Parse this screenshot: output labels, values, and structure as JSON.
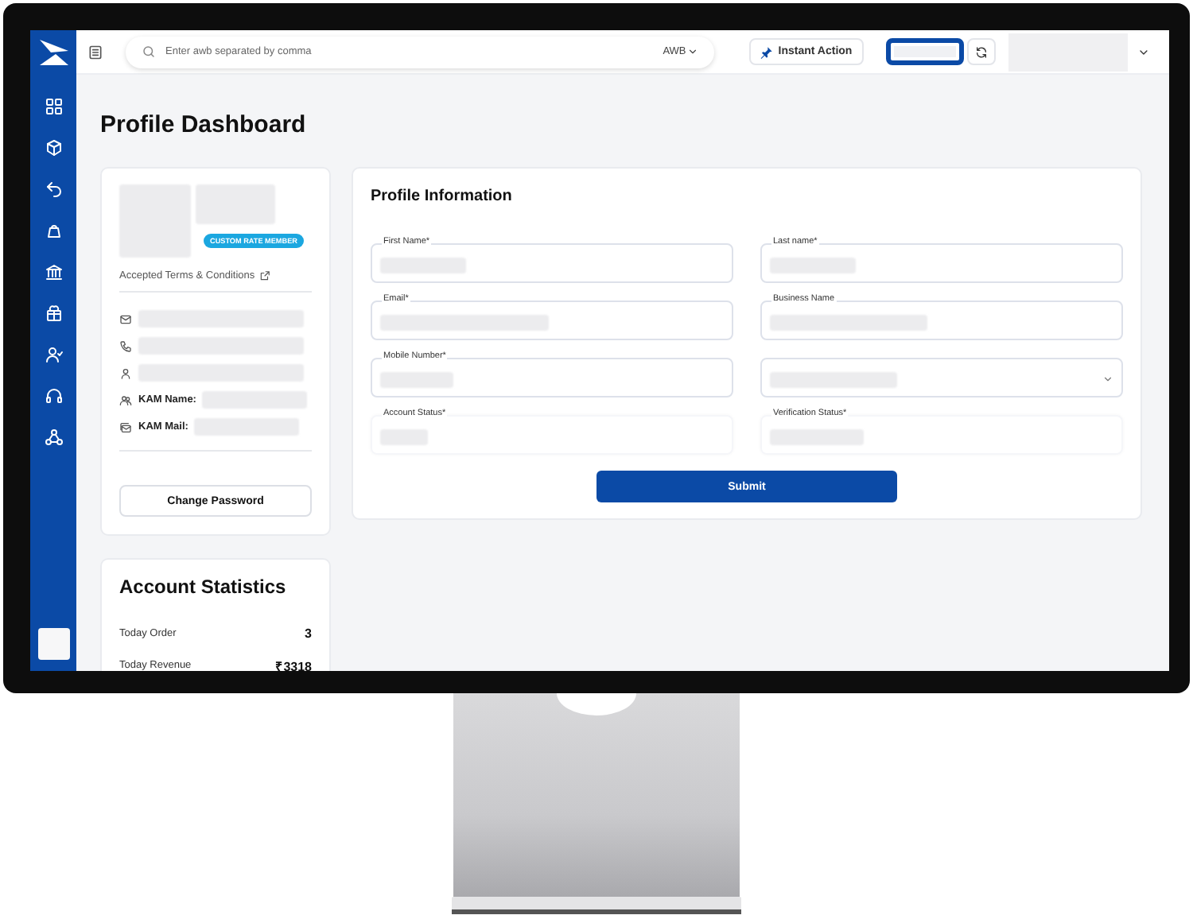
{
  "topbar": {
    "search_placeholder": "Enter awb separated by comma",
    "search_type": "AWB",
    "instant_action": "Instant Action"
  },
  "page_title": "Profile Dashboard",
  "profile_card": {
    "badge": "CUSTOM RATE MEMBER",
    "terms_link": "Accepted Terms & Conditions",
    "details": [
      {
        "kind": "email"
      },
      {
        "kind": "phone"
      },
      {
        "kind": "person"
      },
      {
        "kind": "kam_name",
        "label": "KAM Name:"
      },
      {
        "kind": "kam_mail",
        "label": "KAM Mail:"
      }
    ],
    "change_password": "Change Password"
  },
  "account_statistics": {
    "title": "Account Statistics",
    "rows": [
      {
        "label": "Today Order",
        "value": "3"
      },
      {
        "label": "Today Revenue",
        "value": "₹3318"
      }
    ]
  },
  "profile_form": {
    "title": "Profile Information",
    "fields": [
      {
        "label": "First Name*",
        "kind": "text",
        "disabled": false
      },
      {
        "label": "Last name*",
        "kind": "text",
        "disabled": false
      },
      {
        "label": "Email*",
        "kind": "text",
        "disabled": false
      },
      {
        "label": "Business Name",
        "kind": "text",
        "disabled": false
      },
      {
        "label": "Mobile Number*",
        "kind": "text",
        "disabled": false
      },
      {
        "kind": "select",
        "disabled": false
      },
      {
        "label": "Account Status*",
        "kind": "text",
        "disabled": true
      },
      {
        "label": "Verification Status*",
        "kind": "text",
        "disabled": true
      }
    ],
    "submit": "Submit"
  }
}
